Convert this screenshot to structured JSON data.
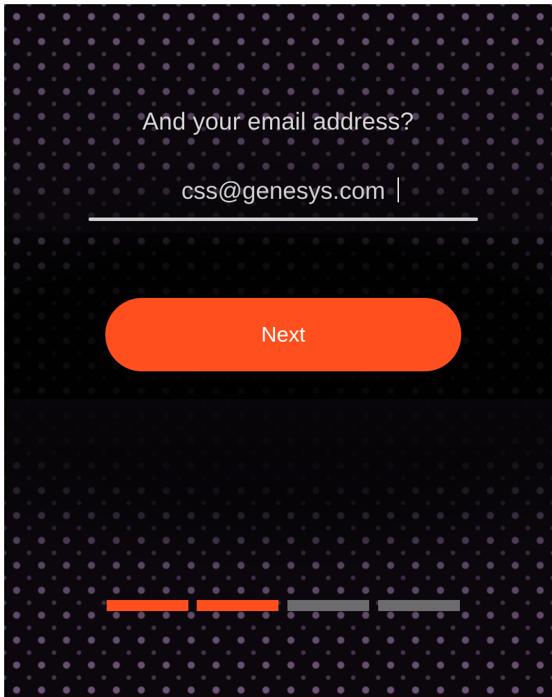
{
  "prompt": {
    "text": "And your email address?"
  },
  "email_field": {
    "value": "css@genesys.com"
  },
  "next_button": {
    "label": "Next"
  },
  "progress": {
    "total_steps": 4,
    "completed_steps": 2,
    "active_color": "#ff4f1f",
    "inactive_color": "#6e6b6f"
  },
  "colors": {
    "accent": "#ff4f1f",
    "background": "#0b070d",
    "dots": "#a582b4",
    "text": "#d6d3d6",
    "underline": "#d2d2d2"
  }
}
